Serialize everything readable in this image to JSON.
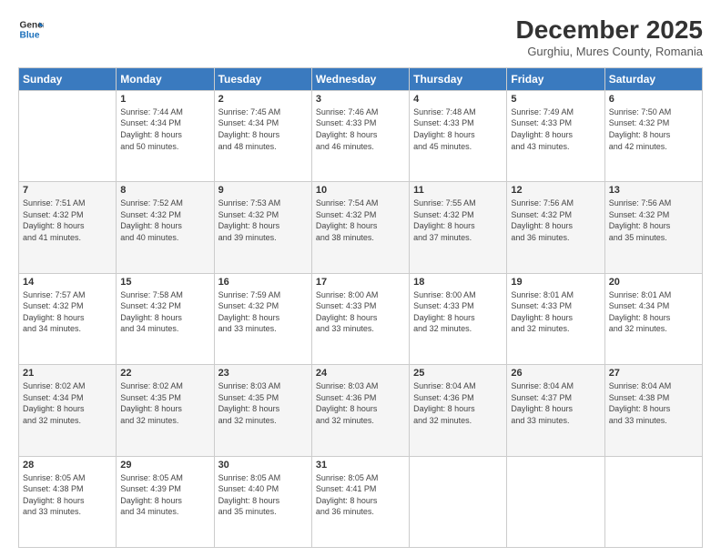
{
  "header": {
    "logo_line1": "General",
    "logo_line2": "Blue",
    "title": "December 2025",
    "subtitle": "Gurghiu, Mures County, Romania"
  },
  "weekdays": [
    "Sunday",
    "Monday",
    "Tuesday",
    "Wednesday",
    "Thursday",
    "Friday",
    "Saturday"
  ],
  "weeks": [
    [
      {
        "day": "",
        "info": ""
      },
      {
        "day": "1",
        "info": "Sunrise: 7:44 AM\nSunset: 4:34 PM\nDaylight: 8 hours\nand 50 minutes."
      },
      {
        "day": "2",
        "info": "Sunrise: 7:45 AM\nSunset: 4:34 PM\nDaylight: 8 hours\nand 48 minutes."
      },
      {
        "day": "3",
        "info": "Sunrise: 7:46 AM\nSunset: 4:33 PM\nDaylight: 8 hours\nand 46 minutes."
      },
      {
        "day": "4",
        "info": "Sunrise: 7:48 AM\nSunset: 4:33 PM\nDaylight: 8 hours\nand 45 minutes."
      },
      {
        "day": "5",
        "info": "Sunrise: 7:49 AM\nSunset: 4:33 PM\nDaylight: 8 hours\nand 43 minutes."
      },
      {
        "day": "6",
        "info": "Sunrise: 7:50 AM\nSunset: 4:32 PM\nDaylight: 8 hours\nand 42 minutes."
      }
    ],
    [
      {
        "day": "7",
        "info": "Sunrise: 7:51 AM\nSunset: 4:32 PM\nDaylight: 8 hours\nand 41 minutes."
      },
      {
        "day": "8",
        "info": "Sunrise: 7:52 AM\nSunset: 4:32 PM\nDaylight: 8 hours\nand 40 minutes."
      },
      {
        "day": "9",
        "info": "Sunrise: 7:53 AM\nSunset: 4:32 PM\nDaylight: 8 hours\nand 39 minutes."
      },
      {
        "day": "10",
        "info": "Sunrise: 7:54 AM\nSunset: 4:32 PM\nDaylight: 8 hours\nand 38 minutes."
      },
      {
        "day": "11",
        "info": "Sunrise: 7:55 AM\nSunset: 4:32 PM\nDaylight: 8 hours\nand 37 minutes."
      },
      {
        "day": "12",
        "info": "Sunrise: 7:56 AM\nSunset: 4:32 PM\nDaylight: 8 hours\nand 36 minutes."
      },
      {
        "day": "13",
        "info": "Sunrise: 7:56 AM\nSunset: 4:32 PM\nDaylight: 8 hours\nand 35 minutes."
      }
    ],
    [
      {
        "day": "14",
        "info": "Sunrise: 7:57 AM\nSunset: 4:32 PM\nDaylight: 8 hours\nand 34 minutes."
      },
      {
        "day": "15",
        "info": "Sunrise: 7:58 AM\nSunset: 4:32 PM\nDaylight: 8 hours\nand 34 minutes."
      },
      {
        "day": "16",
        "info": "Sunrise: 7:59 AM\nSunset: 4:32 PM\nDaylight: 8 hours\nand 33 minutes."
      },
      {
        "day": "17",
        "info": "Sunrise: 8:00 AM\nSunset: 4:33 PM\nDaylight: 8 hours\nand 33 minutes."
      },
      {
        "day": "18",
        "info": "Sunrise: 8:00 AM\nSunset: 4:33 PM\nDaylight: 8 hours\nand 32 minutes."
      },
      {
        "day": "19",
        "info": "Sunrise: 8:01 AM\nSunset: 4:33 PM\nDaylight: 8 hours\nand 32 minutes."
      },
      {
        "day": "20",
        "info": "Sunrise: 8:01 AM\nSunset: 4:34 PM\nDaylight: 8 hours\nand 32 minutes."
      }
    ],
    [
      {
        "day": "21",
        "info": "Sunrise: 8:02 AM\nSunset: 4:34 PM\nDaylight: 8 hours\nand 32 minutes."
      },
      {
        "day": "22",
        "info": "Sunrise: 8:02 AM\nSunset: 4:35 PM\nDaylight: 8 hours\nand 32 minutes."
      },
      {
        "day": "23",
        "info": "Sunrise: 8:03 AM\nSunset: 4:35 PM\nDaylight: 8 hours\nand 32 minutes."
      },
      {
        "day": "24",
        "info": "Sunrise: 8:03 AM\nSunset: 4:36 PM\nDaylight: 8 hours\nand 32 minutes."
      },
      {
        "day": "25",
        "info": "Sunrise: 8:04 AM\nSunset: 4:36 PM\nDaylight: 8 hours\nand 32 minutes."
      },
      {
        "day": "26",
        "info": "Sunrise: 8:04 AM\nSunset: 4:37 PM\nDaylight: 8 hours\nand 33 minutes."
      },
      {
        "day": "27",
        "info": "Sunrise: 8:04 AM\nSunset: 4:38 PM\nDaylight: 8 hours\nand 33 minutes."
      }
    ],
    [
      {
        "day": "28",
        "info": "Sunrise: 8:05 AM\nSunset: 4:38 PM\nDaylight: 8 hours\nand 33 minutes."
      },
      {
        "day": "29",
        "info": "Sunrise: 8:05 AM\nSunset: 4:39 PM\nDaylight: 8 hours\nand 34 minutes."
      },
      {
        "day": "30",
        "info": "Sunrise: 8:05 AM\nSunset: 4:40 PM\nDaylight: 8 hours\nand 35 minutes."
      },
      {
        "day": "31",
        "info": "Sunrise: 8:05 AM\nSunset: 4:41 PM\nDaylight: 8 hours\nand 36 minutes."
      },
      {
        "day": "",
        "info": ""
      },
      {
        "day": "",
        "info": ""
      },
      {
        "day": "",
        "info": ""
      }
    ]
  ]
}
